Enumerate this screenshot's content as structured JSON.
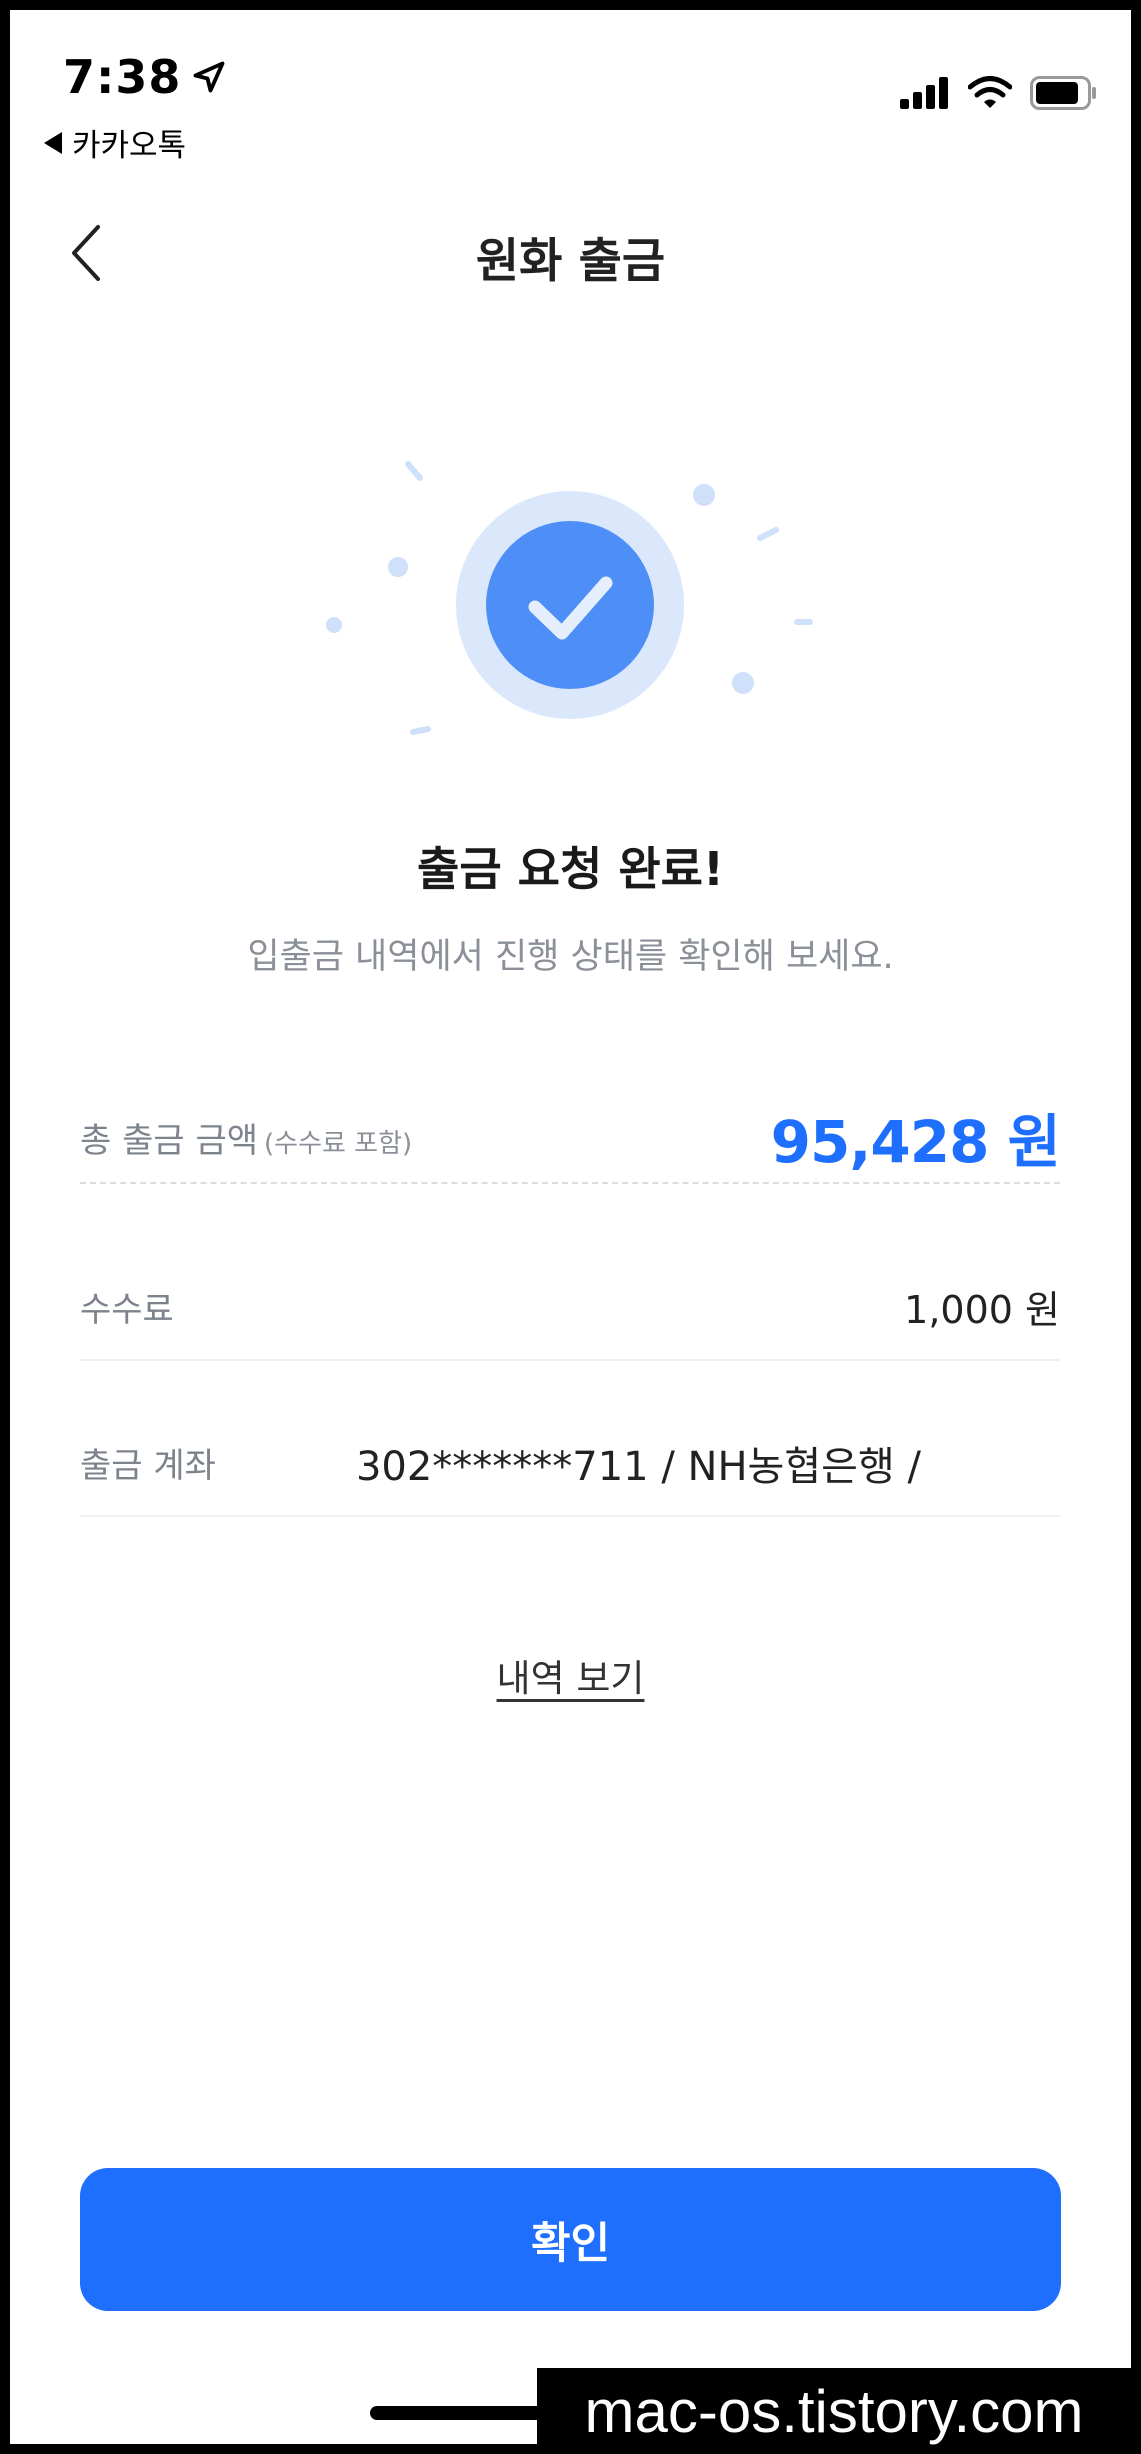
{
  "status_bar": {
    "time": "7:38",
    "back_app": "카카오톡"
  },
  "nav": {
    "title": "원화 출금"
  },
  "result": {
    "title": "출금 요청 완료!",
    "subtitle": "입출금 내역에서 진행 상태를 확인해 보세요."
  },
  "details": {
    "total_label": "총 출금 금액",
    "total_note": "(수수료 포함)",
    "total_amount": "95,428 원",
    "fee_label": "수수료",
    "fee_value": "1,000 원",
    "account_label": "출금 계좌",
    "account_value": "302*******711 / NH농협은행 /"
  },
  "history_link": "내역 보기",
  "confirm_button": "확인",
  "watermark": "mac-os.tistory.com",
  "colors": {
    "accent": "#1f6fff",
    "check_circle": "#4e8ef7",
    "check_halo": "#dbe8fc"
  }
}
